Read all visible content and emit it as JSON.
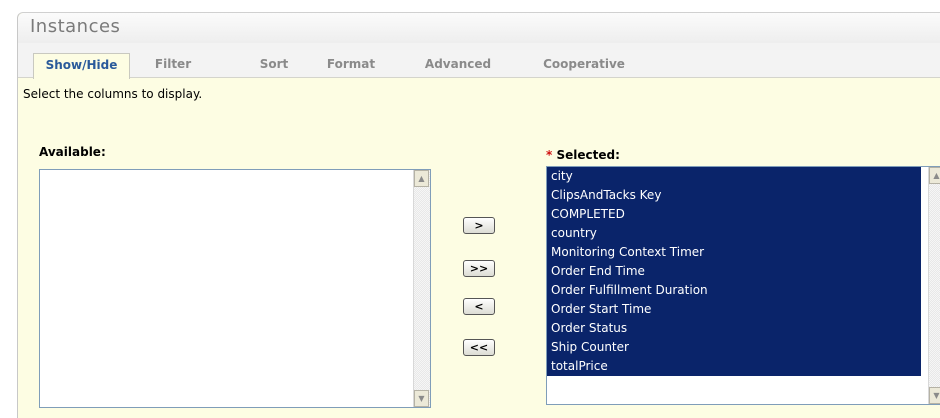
{
  "panel": {
    "title": "Instances"
  },
  "tabs": [
    {
      "label": "Show/Hide",
      "active": true
    },
    {
      "label": "Filter"
    },
    {
      "label": "Sort"
    },
    {
      "label": "Format"
    },
    {
      "label": "Advanced"
    },
    {
      "label": "Cooperative"
    }
  ],
  "instruction": "Select the columns to display.",
  "available": {
    "label": "Available:",
    "items": []
  },
  "selected": {
    "required_marker": "*",
    "label": "Selected:",
    "items": [
      "city",
      "ClipsAndTacks Key",
      "COMPLETED",
      "country",
      "Monitoring Context Timer",
      "Order End Time",
      "Order Fulfillment Duration",
      "Order Start Time",
      "Order Status",
      "Ship Counter",
      "totalPrice"
    ]
  },
  "buttons": {
    "add": ">",
    "add_all": ">>",
    "remove": "<",
    "remove_all": "<<"
  },
  "scroll_icons": {
    "up": "up-arrow-icon",
    "down": "down-arrow-icon"
  },
  "colors": {
    "panel_bg": "#fdfde3",
    "selection": "#0a246a",
    "active_tab": "#2a5a9a",
    "required": "#d01010"
  }
}
